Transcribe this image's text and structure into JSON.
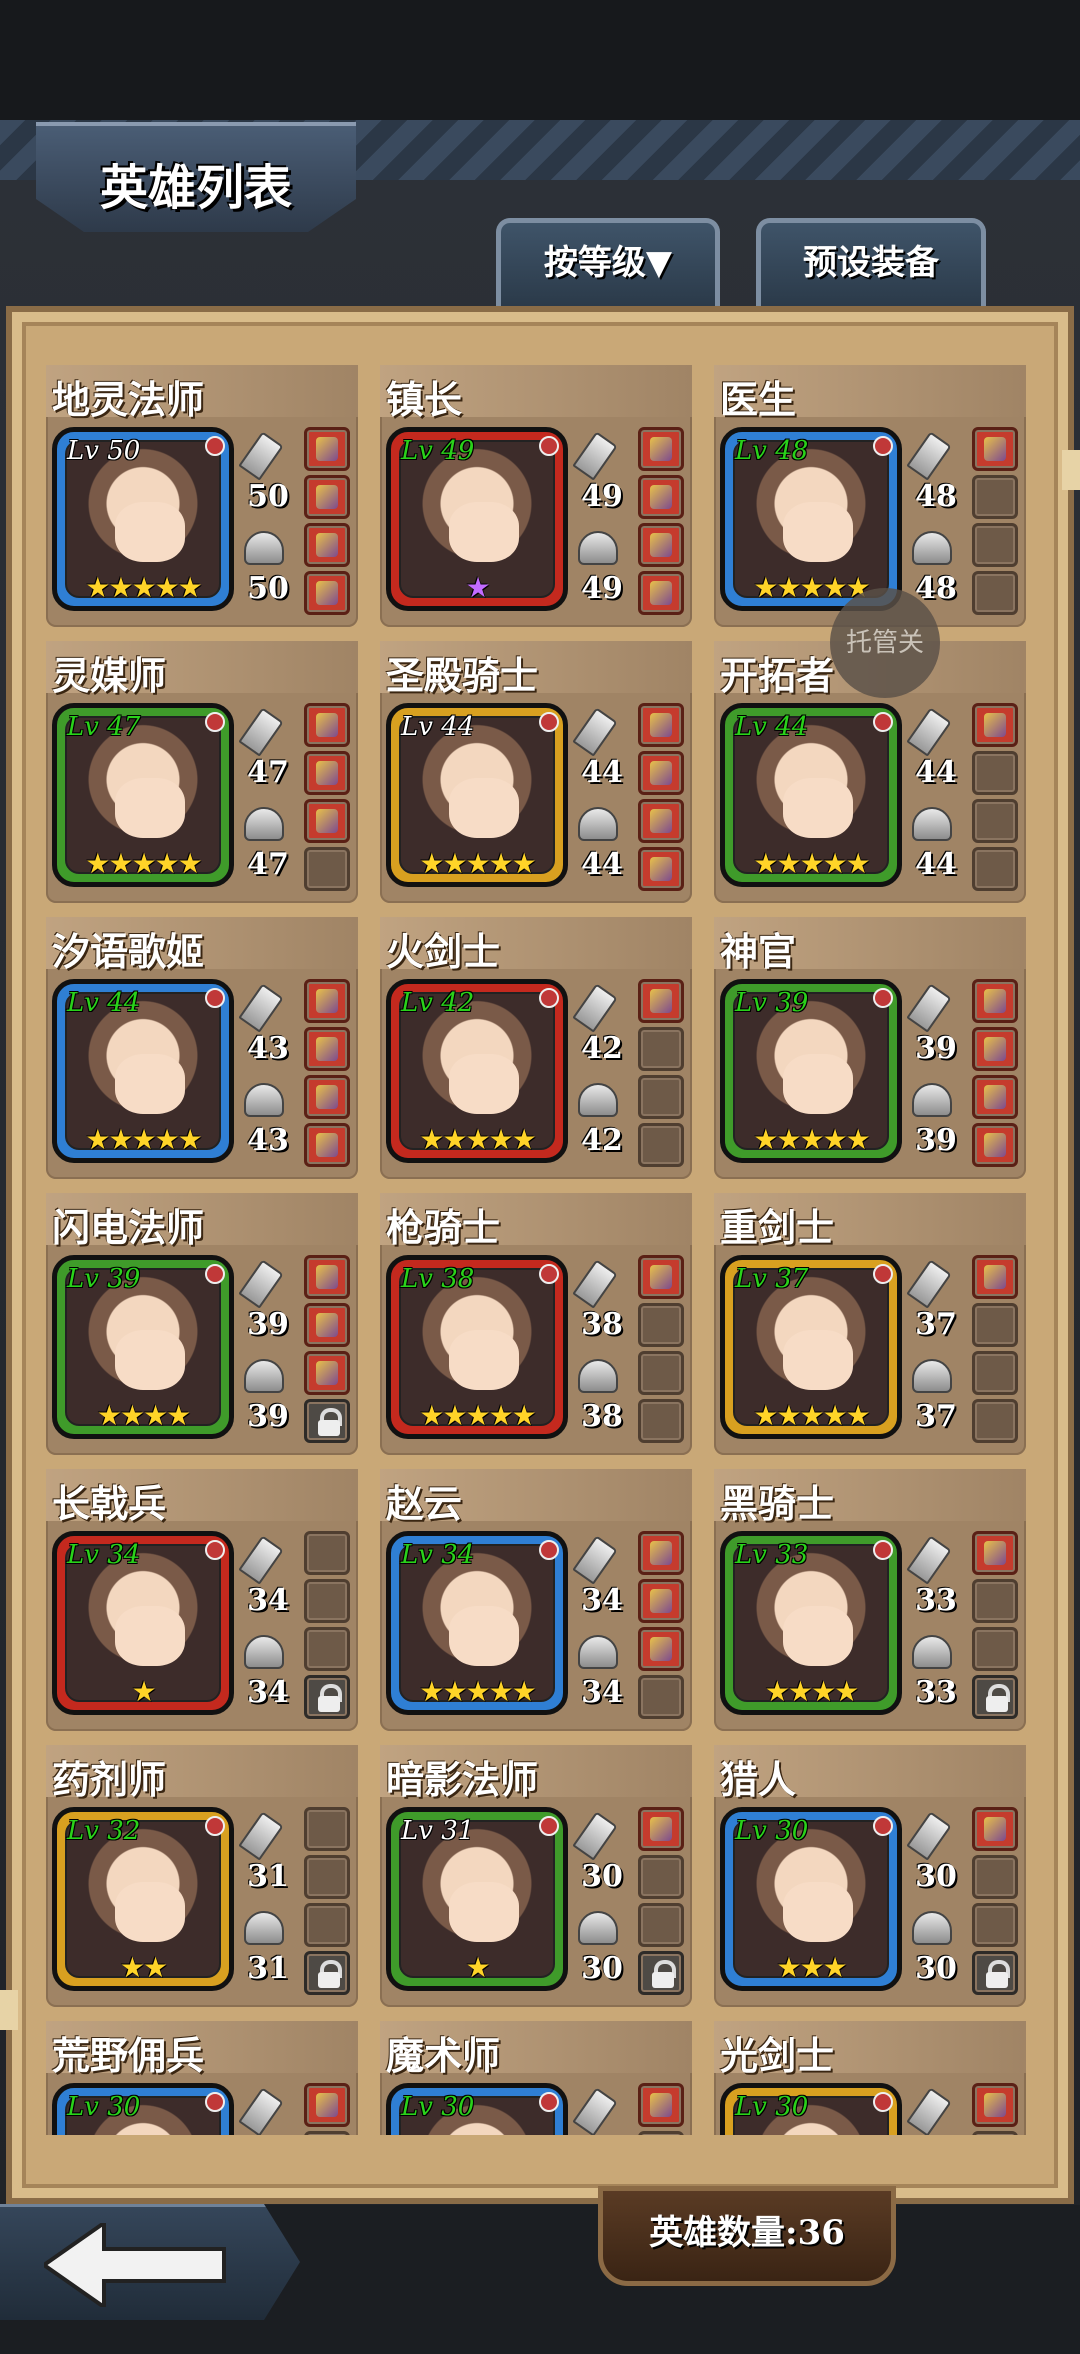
{
  "header": {
    "title": "英雄列表"
  },
  "tabs": [
    {
      "label": "按等级▼"
    },
    {
      "label": "预设装备"
    }
  ],
  "float_button": {
    "label": "托管关"
  },
  "footer": {
    "hero_count": "英雄数量:36"
  },
  "heroes": [
    {
      "name": "地灵法师",
      "level": "Lv 50",
      "level_color": "white",
      "weapon": "50",
      "armor": "50",
      "frame": "blue",
      "stars": "★★★★★",
      "star_color": "gold",
      "slots": [
        "filled",
        "filled",
        "filled",
        "filled"
      ]
    },
    {
      "name": "镇长",
      "level": "Lv 49",
      "level_color": "green",
      "weapon": "49",
      "armor": "49",
      "frame": "red",
      "stars": "★",
      "star_color": "purple",
      "slots": [
        "filled",
        "filled",
        "filled",
        "filled"
      ]
    },
    {
      "name": "医生",
      "level": "Lv 48",
      "level_color": "green",
      "weapon": "48",
      "armor": "48",
      "frame": "blue",
      "stars": "★★★★★",
      "star_color": "gold",
      "slots": [
        "filled",
        "empty",
        "empty",
        "empty"
      ]
    },
    {
      "name": "灵媒师",
      "level": "Lv 47",
      "level_color": "green",
      "weapon": "47",
      "armor": "47",
      "frame": "green",
      "stars": "★★★★★",
      "star_color": "gold",
      "slots": [
        "filled",
        "filled",
        "filled",
        "empty"
      ]
    },
    {
      "name": "圣殿骑士",
      "level": "Lv 44",
      "level_color": "white",
      "weapon": "44",
      "armor": "44",
      "frame": "yellow",
      "stars": "★★★★★",
      "star_color": "gold",
      "slots": [
        "filled",
        "filled",
        "filled",
        "filled"
      ]
    },
    {
      "name": "开拓者",
      "level": "Lv 44",
      "level_color": "green",
      "weapon": "44",
      "armor": "44",
      "frame": "green",
      "stars": "★★★★★",
      "star_color": "gold",
      "slots": [
        "filled",
        "empty",
        "empty",
        "empty"
      ]
    },
    {
      "name": "汐语歌姬",
      "level": "Lv 44",
      "level_color": "green",
      "weapon": "43",
      "armor": "43",
      "frame": "blue",
      "stars": "★★★★★",
      "star_color": "gold",
      "slots": [
        "filled",
        "filled",
        "filled",
        "filled"
      ]
    },
    {
      "name": "火剑士",
      "level": "Lv 42",
      "level_color": "green",
      "weapon": "42",
      "armor": "42",
      "frame": "red",
      "stars": "★★★★★",
      "star_color": "gold",
      "slots": [
        "filled",
        "empty",
        "empty",
        "empty"
      ]
    },
    {
      "name": "神官",
      "level": "Lv 39",
      "level_color": "green",
      "weapon": "39",
      "armor": "39",
      "frame": "green",
      "stars": "★★★★★",
      "star_color": "gold",
      "slots": [
        "filled",
        "filled",
        "filled",
        "filled"
      ]
    },
    {
      "name": "闪电法师",
      "level": "Lv 39",
      "level_color": "green",
      "weapon": "39",
      "armor": "39",
      "frame": "green",
      "stars": "★★★★",
      "star_color": "gold",
      "slots": [
        "filled",
        "filled",
        "filled",
        "lock"
      ]
    },
    {
      "name": "枪骑士",
      "level": "Lv 38",
      "level_color": "green",
      "weapon": "38",
      "armor": "38",
      "frame": "red",
      "stars": "★★★★★",
      "star_color": "gold",
      "slots": [
        "filled",
        "empty",
        "empty",
        "empty"
      ]
    },
    {
      "name": "重剑士",
      "level": "Lv 37",
      "level_color": "green",
      "weapon": "37",
      "armor": "37",
      "frame": "yellow",
      "stars": "★★★★★",
      "star_color": "gold",
      "slots": [
        "filled",
        "empty",
        "empty",
        "empty"
      ]
    },
    {
      "name": "长戟兵",
      "level": "Lv 34",
      "level_color": "green",
      "weapon": "34",
      "armor": "34",
      "frame": "red",
      "stars": "★",
      "star_color": "gold",
      "slots": [
        "empty",
        "empty",
        "empty",
        "lock"
      ]
    },
    {
      "name": "赵云",
      "level": "Lv 34",
      "level_color": "green",
      "weapon": "34",
      "armor": "34",
      "frame": "blue",
      "stars": "★★★★★",
      "star_color": "gold",
      "slots": [
        "filled",
        "filled",
        "filled",
        "empty"
      ]
    },
    {
      "name": "黑骑士",
      "level": "Lv 33",
      "level_color": "green",
      "weapon": "33",
      "armor": "33",
      "frame": "green",
      "stars": "★★★★",
      "star_color": "gold",
      "slots": [
        "filled",
        "empty",
        "empty",
        "lock"
      ]
    },
    {
      "name": "药剂师",
      "level": "Lv 32",
      "level_color": "green",
      "weapon": "31",
      "armor": "31",
      "frame": "yellow",
      "stars": "★★",
      "star_color": "gold",
      "slots": [
        "empty",
        "empty",
        "empty",
        "lock"
      ]
    },
    {
      "name": "暗影法师",
      "level": "Lv 31",
      "level_color": "white",
      "weapon": "30",
      "armor": "30",
      "frame": "green",
      "stars": "★",
      "star_color": "gold",
      "slots": [
        "filled",
        "empty",
        "empty",
        "lock"
      ]
    },
    {
      "name": "猎人",
      "level": "Lv 30",
      "level_color": "green",
      "weapon": "30",
      "armor": "30",
      "frame": "blue",
      "stars": "★★★",
      "star_color": "gold",
      "slots": [
        "filled",
        "empty",
        "empty",
        "lock"
      ]
    },
    {
      "name": "荒野佣兵",
      "level": "Lv 30",
      "level_color": "green",
      "weapon": "",
      "armor": "",
      "frame": "blue",
      "stars": "",
      "star_color": "gold",
      "slots": [
        "filled",
        "empty",
        "empty",
        "empty"
      ]
    },
    {
      "name": "魔术师",
      "level": "Lv 30",
      "level_color": "green",
      "weapon": "",
      "armor": "",
      "frame": "blue",
      "stars": "",
      "star_color": "gold",
      "slots": [
        "filled",
        "empty",
        "empty",
        "empty"
      ]
    },
    {
      "name": "光剑士",
      "level": "Lv 30",
      "level_color": "green",
      "weapon": "",
      "armor": "",
      "frame": "yellow",
      "stars": "",
      "star_color": "gold",
      "slots": [
        "filled",
        "empty",
        "empty",
        "empty"
      ]
    }
  ]
}
